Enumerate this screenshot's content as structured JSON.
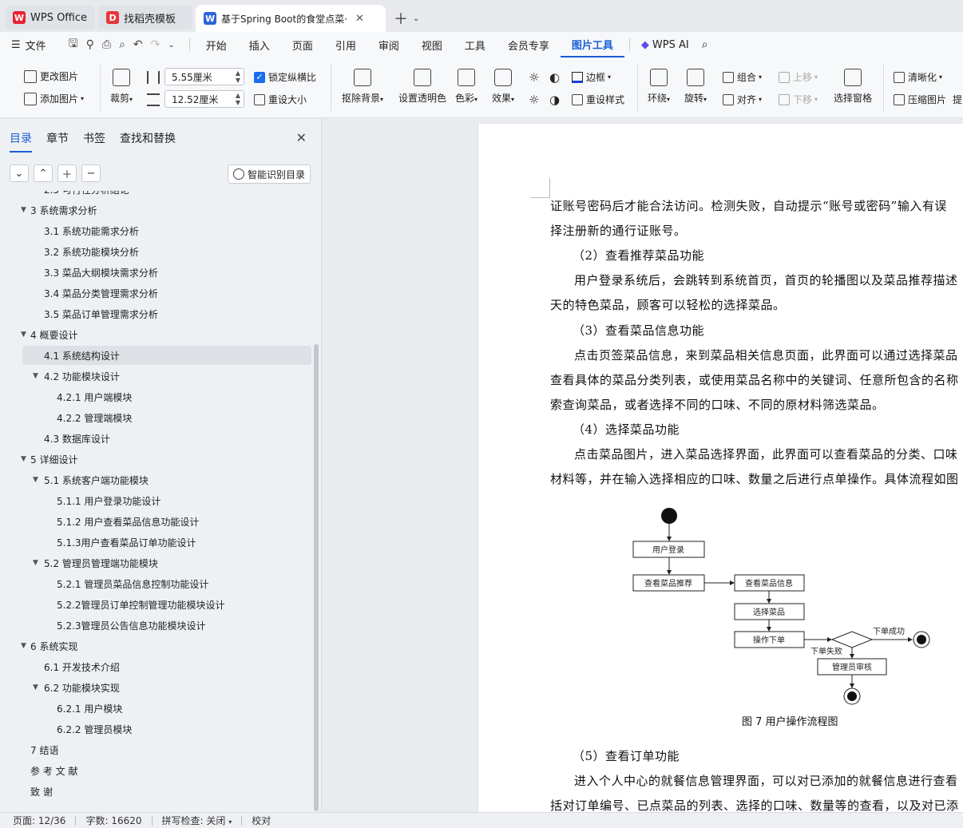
{
  "tabs": [
    {
      "label": "WPS Office",
      "icon": "wps-logo-icon"
    },
    {
      "label": "找稻壳模板",
      "icon": "docer-icon"
    },
    {
      "label": "基于Spring Boot的食堂点菜·",
      "icon": "writer-icon",
      "active": true
    }
  ],
  "menubar": {
    "file": "文件",
    "items": [
      "开始",
      "插入",
      "页面",
      "引用",
      "审阅",
      "视图",
      "工具",
      "会员专享",
      "图片工具"
    ],
    "active": "图片工具",
    "wps_ai": "WPS AI"
  },
  "ribbon": {
    "change_image": "更改图片",
    "add_image": "添加图片",
    "crop": "裁剪",
    "width_value": "5.55厘米",
    "height_value": "12.52厘米",
    "lock_ratio": "锁定纵横比",
    "reset_size": "重设大小",
    "remove_bg": "抠除背景",
    "set_transparent": "设置透明色",
    "color": "色彩",
    "effect": "效果",
    "border": "边框",
    "reset_style": "重设样式",
    "wrap": "环绕",
    "rotate": "旋转",
    "group": "组合",
    "align": "对齐",
    "move_up": "上移",
    "move_down": "下移",
    "selection_pane": "选择窗格",
    "sharpen": "清晰化",
    "compress": "压缩图片",
    "more": "提"
  },
  "nav": {
    "tabs": [
      "目录",
      "章节",
      "书签",
      "查找和替换"
    ],
    "active_tab": "目录",
    "smart_button": "智能识别目录",
    "toc": [
      {
        "label": "2.5 可行性分析结论",
        "level": 2
      },
      {
        "label": "3  系统需求分析",
        "level": 1,
        "expanded": true
      },
      {
        "label": "3.1  系统功能需求分析",
        "level": 2
      },
      {
        "label": "3.2  系统功能模块分析",
        "level": 2
      },
      {
        "label": "3.3  菜品大纲模块需求分析",
        "level": 2
      },
      {
        "label": "3.4  菜品分类管理需求分析",
        "level": 2
      },
      {
        "label": "3.5  菜品订单管理需求分析",
        "level": 2
      },
      {
        "label": "4  概要设计",
        "level": 1,
        "expanded": true
      },
      {
        "label": "4.1  系统结构设计",
        "level": 2,
        "selected": true
      },
      {
        "label": "4.2  功能模块设计",
        "level": 2,
        "expanded": true
      },
      {
        "label": "4.2.1  用户端模块",
        "level": 3
      },
      {
        "label": "4.2.2  管理端模块",
        "level": 3
      },
      {
        "label": "4.3  数据库设计",
        "level": 2
      },
      {
        "label": "5  详细设计",
        "level": 1,
        "expanded": true
      },
      {
        "label": "5.1  系统客户端功能模块",
        "level": 2,
        "expanded": true
      },
      {
        "label": "5.1.1  用户登录功能设计",
        "level": 3
      },
      {
        "label": "5.1.2  用户查看菜品信息功能设计",
        "level": 3
      },
      {
        "label": "5.1.3用户查看菜品订单功能设计",
        "level": 3
      },
      {
        "label": "5.2  管理员管理端功能模块",
        "level": 2,
        "expanded": true
      },
      {
        "label": "5.2.1  管理员菜品信息控制功能设计",
        "level": 3
      },
      {
        "label": "5.2.2管理员订单控制管理功能模块设计",
        "level": 3
      },
      {
        "label": "5.2.3管理员公告信息功能模块设计",
        "level": 3
      },
      {
        "label": "6  系统实现",
        "level": 1,
        "expanded": true
      },
      {
        "label": "6.1  开发技术介绍",
        "level": 2
      },
      {
        "label": "6.2  功能模块实现",
        "level": 2,
        "expanded": true
      },
      {
        "label": "6.2.1  用户模块",
        "level": 3
      },
      {
        "label": "6.2.2  管理员模块",
        "level": 3
      },
      {
        "label": "7  结语",
        "level": 1
      },
      {
        "label": "参  考  文  献",
        "level": 1
      },
      {
        "label": "致        谢",
        "level": 1
      }
    ]
  },
  "document": {
    "lines": [
      "证账号密码后才能合法访问。检测失败，自动提示“账号或密码”输入有误",
      "择注册新的通行证账号。",
      "（2）查看推荐菜品功能",
      "用户登录系统后，会跳转到系统首页，首页的轮播图以及菜品推荐描述",
      "天的特色菜品，顾客可以轻松的选择菜品。",
      "（3）查看菜品信息功能",
      "点击页签菜品信息，来到菜品相关信息页面，此界面可以通过选择菜品",
      "查看具体的菜品分类列表，或使用菜品名称中的关键词、任意所包含的名称",
      "索查询菜品，或者选择不同的口味、不同的原材料筛选菜品。",
      "（4）选择菜品功能",
      "点击菜品图片，进入菜品选择界面，此界面可以查看菜品的分类、口味",
      "材料等，并在输入选择相应的口味、数量之后进行点单操作。具体流程如图",
      "（5）查看订单功能",
      "进入个人中心的就餐信息管理界面，可以对已添加的就餐信息进行查看",
      "括对订单编号、已点菜品的列表、选择的口味、数量等的查看，以及对已添"
    ],
    "figure_caption": "图 7  用户操作流程图",
    "diagram": {
      "user_login": "用户登录",
      "view_recommend": "查看菜品推荐",
      "view_info": "查看菜品信息",
      "select_dish": "选择菜品",
      "place_order": "操作下单",
      "order_success": "下单成功",
      "order_fail": "下单失败",
      "admin_review": "管理员审核"
    }
  },
  "status": {
    "page": "页面: 12/36",
    "words": "字数: 16620",
    "spell": "拼写检查: 关闭",
    "proof": "校对"
  },
  "colors": {
    "accent": "#1a5fd6",
    "wps_red": "#e8232f",
    "docer_red": "#e5383b",
    "writer_blue": "#2b62d9"
  }
}
